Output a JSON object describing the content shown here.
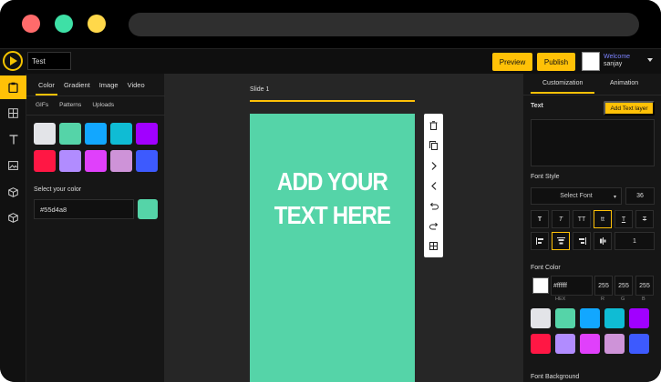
{
  "header": {
    "project_name": "Test",
    "preview_label": "Preview",
    "publish_label": "Publish",
    "welcome_text": "Welcome",
    "username": "sanjay"
  },
  "rail": {
    "items": [
      "clipboard-icon",
      "layout-icon",
      "text-icon",
      "image-icon",
      "cube-icon",
      "box-icon"
    ]
  },
  "left_panel": {
    "tabs": [
      "Color",
      "Gradient",
      "Image",
      "Video"
    ],
    "subtabs": [
      "GIFs",
      "Patterns",
      "Uploads"
    ],
    "swatches": [
      "#e3e4e8",
      "#55d4a8",
      "#12a7ff",
      "#0fbcd4",
      "#a100ff",
      "#ff1744",
      "#b18cff",
      "#e040fb",
      "#ce93d8",
      "#3d5afe"
    ],
    "select_color_label": "Select your color",
    "selected_hex": "#55d4a8",
    "selected_color": "#55d4a8"
  },
  "canvas": {
    "slide_label": "Slide 1",
    "slide_bg": "#55d4a8",
    "slide_text_line1": "ADD YOUR",
    "slide_text_line2": "TEXT HERE",
    "toolbar_icons": [
      "trash-icon",
      "copy-icon",
      "chevron-right-icon",
      "chevron-left-icon",
      "undo-icon",
      "redo-icon",
      "grid-icon"
    ]
  },
  "right_panel": {
    "tabs": [
      "Customization",
      "Animation"
    ],
    "text_label": "Text",
    "add_text_layer_label": "Add Text layer",
    "font_style_label": "Font Style",
    "font_select_value": "Select Font",
    "font_size": "36",
    "format_buttons": [
      "T",
      "T",
      "TT",
      "tt",
      "T",
      "T"
    ],
    "align_buttons": [
      "align-left-icon",
      "align-center-icon",
      "align-right-icon",
      "align-justify-icon"
    ],
    "line_height": "1",
    "font_color_label": "Font Color",
    "font_color_hex": "#ffffff",
    "rgb": [
      "255",
      "255",
      "255"
    ],
    "rgb_caps": [
      "HEX",
      "R",
      "G",
      "B"
    ],
    "swatches": [
      "#e3e4e8",
      "#55d4a8",
      "#12a7ff",
      "#0fbcd4",
      "#a100ff",
      "#ff1744",
      "#b18cff",
      "#e040fb",
      "#ce93d8",
      "#3d5afe"
    ],
    "font_background_label": "Font Background"
  }
}
